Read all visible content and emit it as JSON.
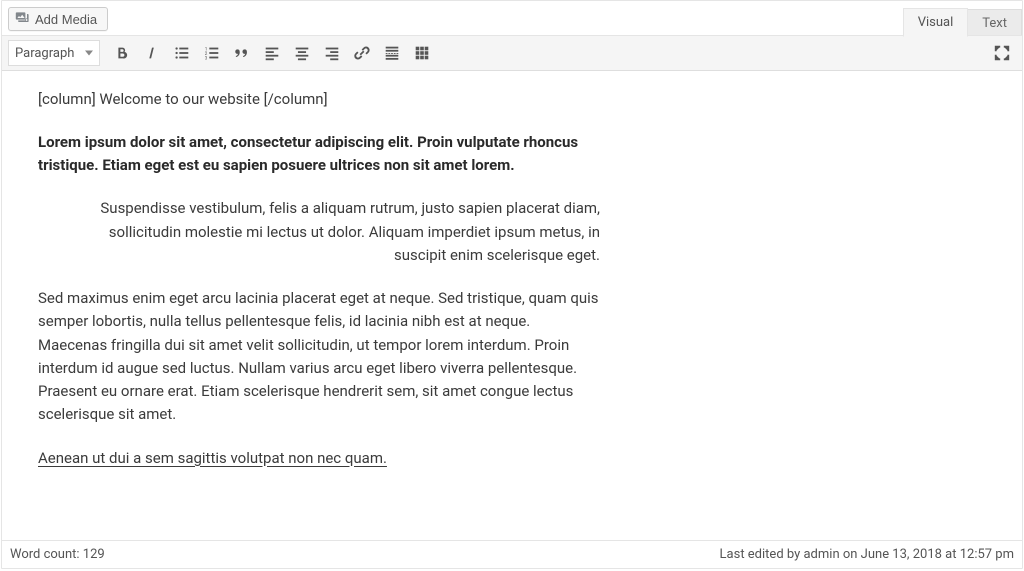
{
  "topbar": {
    "add_media_label": "Add Media"
  },
  "tabs": {
    "visual": "Visual",
    "text": "Text"
  },
  "toolbar": {
    "format_selected": "Paragraph"
  },
  "content": {
    "p1": "[column] Welcome to our website [/column]",
    "p2": "Lorem ipsum dolor sit amet, consectetur adipiscing elit. Proin vulputate rhoncus tristique. Etiam eget est eu sapien posuere ultrices non sit amet lorem.",
    "p3": "Suspendisse vestibulum, felis a aliquam rutrum, justo sapien placerat diam, sollicitudin molestie mi lectus ut dolor. Aliquam imperdiet ipsum metus, in suscipit enim scelerisque eget.",
    "p4": "Sed maximus enim eget arcu lacinia placerat eget at neque. Sed tristique, quam quis semper lobortis, nulla tellus pellentesque felis, id lacinia nibh est at neque. Maecenas fringilla dui sit amet velit sollicitudin, ut tempor lorem interdum. Proin interdum id augue sed luctus. Nullam varius arcu eget libero viverra pellentesque. Praesent eu ornare erat. Etiam scelerisque hendrerit sem, sit amet congue lectus scelerisque sit amet.",
    "p5": "Aenean ut dui a sem sagittis volutpat non nec quam."
  },
  "status": {
    "word_count_label": "Word count: 129",
    "last_edited": "Last edited by admin on June 13, 2018 at 12:57 pm"
  }
}
